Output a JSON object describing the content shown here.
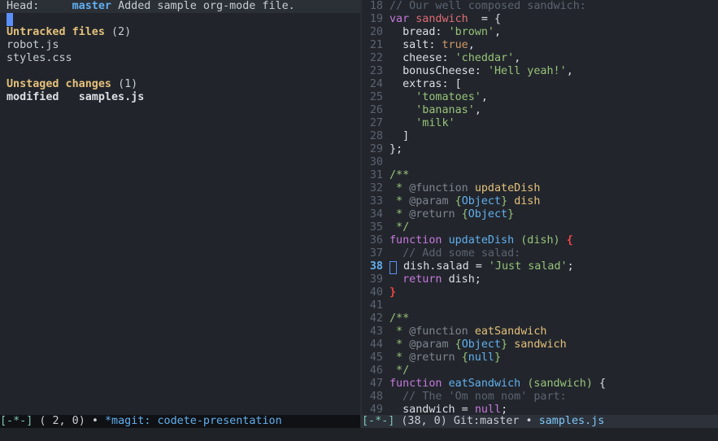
{
  "magit": {
    "head_label": "Head:",
    "head_branch": "master",
    "head_message": "Added sample org-mode file.",
    "untracked_title": "Untracked files",
    "untracked_count": "(2)",
    "untracked_files": [
      "robot.js",
      "styles.css"
    ],
    "unstaged_title": "Unstaged changes",
    "unstaged_count": "(1)",
    "unstaged_status": "modified",
    "unstaged_file": "samples.js"
  },
  "editor": {
    "file": "samples.js",
    "lines": [
      {
        "n": "18",
        "tokens": [
          [
            "t-comment",
            "// Our well composed sandwich:"
          ]
        ]
      },
      {
        "n": "19",
        "tokens": [
          [
            "t-kw",
            "var "
          ],
          [
            "t-var",
            "sandwich"
          ],
          [
            "",
            "  = {"
          ]
        ]
      },
      {
        "n": "20",
        "tokens": [
          [
            "",
            "  bread: "
          ],
          [
            "t-str",
            "'brown'"
          ],
          [
            "",
            ","
          ]
        ]
      },
      {
        "n": "21",
        "tokens": [
          [
            "",
            "  salt: "
          ],
          [
            "t-bool",
            "true"
          ],
          [
            "",
            ","
          ]
        ]
      },
      {
        "n": "22",
        "tokens": [
          [
            "",
            "  cheese: "
          ],
          [
            "t-str",
            "'cheddar'"
          ],
          [
            "",
            ","
          ]
        ]
      },
      {
        "n": "23",
        "tokens": [
          [
            "",
            "  bonusCheese: "
          ],
          [
            "t-str",
            "'Hell yeah!'"
          ],
          [
            "",
            ","
          ]
        ]
      },
      {
        "n": "24",
        "tokens": [
          [
            "",
            "  extras: ["
          ]
        ]
      },
      {
        "n": "25",
        "tokens": [
          [
            "t-str",
            "    'tomatoes'"
          ],
          [
            "",
            ","
          ]
        ]
      },
      {
        "n": "26",
        "tokens": [
          [
            "t-str",
            "    'bananas'"
          ],
          [
            "",
            ","
          ]
        ]
      },
      {
        "n": "27",
        "tokens": [
          [
            "t-str",
            "    'milk'"
          ]
        ]
      },
      {
        "n": "28",
        "tokens": [
          [
            "",
            "  ]"
          ]
        ]
      },
      {
        "n": "29",
        "tokens": [
          [
            "",
            "};"
          ]
        ]
      },
      {
        "n": "30",
        "tokens": []
      },
      {
        "n": "31",
        "tokens": [
          [
            "t-doc",
            "/**"
          ]
        ]
      },
      {
        "n": "32",
        "tokens": [
          [
            "t-doc",
            " * "
          ],
          [
            "t-tag",
            "@function "
          ],
          [
            "t-doc-name",
            "updateDish"
          ]
        ]
      },
      {
        "n": "33",
        "tokens": [
          [
            "t-doc",
            " * "
          ],
          [
            "t-tag",
            "@param "
          ],
          [
            "t-doc",
            "{"
          ],
          [
            "t-type",
            "Object"
          ],
          [
            "t-doc",
            "} "
          ],
          [
            "t-doc-name",
            "dish"
          ]
        ]
      },
      {
        "n": "34",
        "tokens": [
          [
            "t-doc",
            " * "
          ],
          [
            "t-tag",
            "@return "
          ],
          [
            "t-doc",
            "{"
          ],
          [
            "t-type",
            "Object"
          ],
          [
            "t-doc",
            "}"
          ]
        ]
      },
      {
        "n": "35",
        "tokens": [
          [
            "t-doc",
            " */"
          ]
        ]
      },
      {
        "n": "36",
        "tokens": [
          [
            "t-kw",
            "function "
          ],
          [
            "t-fn",
            "updateDish "
          ],
          [
            "t-param",
            "(dish) "
          ],
          [
            "t-brace-red",
            "{"
          ]
        ]
      },
      {
        "n": "37",
        "tokens": [
          [
            "t-comment",
            "  // Add some salad:"
          ]
        ]
      },
      {
        "n": "38",
        "cur": true,
        "tokens": [
          [
            "",
            ""
          ],
          [
            "cursor",
            ""
          ],
          [
            "",
            "",
            " dish.salad = "
          ],
          [
            "t-str",
            "'Just salad'"
          ],
          [
            "",
            ";"
          ]
        ]
      },
      {
        "n": "39",
        "tokens": [
          [
            "t-kw",
            "  return "
          ],
          [
            "",
            "dish;"
          ]
        ]
      },
      {
        "n": "40",
        "tokens": [
          [
            "t-brace-red",
            "}"
          ]
        ]
      },
      {
        "n": "41",
        "tokens": []
      },
      {
        "n": "42",
        "tokens": [
          [
            "t-doc",
            "/**"
          ]
        ]
      },
      {
        "n": "43",
        "tokens": [
          [
            "t-doc",
            " * "
          ],
          [
            "t-tag",
            "@function "
          ],
          [
            "t-doc-name",
            "eatSandwich"
          ]
        ]
      },
      {
        "n": "44",
        "tokens": [
          [
            "t-doc",
            " * "
          ],
          [
            "t-tag",
            "@param "
          ],
          [
            "t-doc",
            "{"
          ],
          [
            "t-type",
            "Object"
          ],
          [
            "t-doc",
            "} "
          ],
          [
            "t-doc-name",
            "sandwich"
          ]
        ]
      },
      {
        "n": "45",
        "tokens": [
          [
            "t-doc",
            " * "
          ],
          [
            "t-tag",
            "@return "
          ],
          [
            "t-doc",
            "{"
          ],
          [
            "t-type",
            "null"
          ],
          [
            "t-doc",
            "}"
          ]
        ]
      },
      {
        "n": "46",
        "tokens": [
          [
            "t-doc",
            " */"
          ]
        ]
      },
      {
        "n": "47",
        "tokens": [
          [
            "t-kw",
            "function "
          ],
          [
            "t-fn",
            "eatSandwich "
          ],
          [
            "t-param",
            "(sandwich) "
          ],
          [
            "",
            "{"
          ]
        ]
      },
      {
        "n": "48",
        "tokens": [
          [
            "t-comment",
            "  // The 'Om nom nom' part:"
          ]
        ]
      },
      {
        "n": "49",
        "tokens": [
          [
            "",
            "  sandwich = "
          ],
          [
            "t-kw",
            "null"
          ],
          [
            "",
            ";"
          ]
        ]
      }
    ]
  },
  "modeline_left": {
    "state": "[-*-]",
    "pos": " ( 2, 0) • ",
    "buffer": "*magit: codete-presentation"
  },
  "modeline_right": {
    "state": "[-*-]",
    "pos": " (38, 0) Git:master • ",
    "buffer": "samples.js"
  }
}
